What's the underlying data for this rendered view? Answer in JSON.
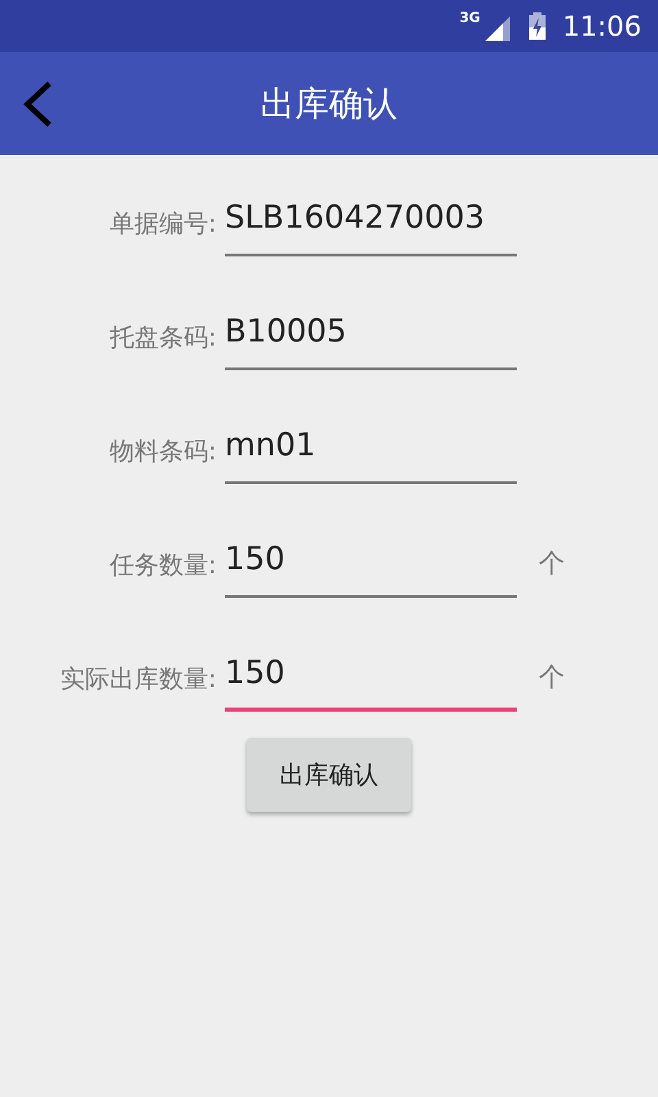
{
  "status_bar": {
    "network": "3G",
    "time": "11:06"
  },
  "app_bar": {
    "title": "出库确认"
  },
  "fields": [
    {
      "label": "单据编号:",
      "value": "SLB1604270003",
      "focused": false
    },
    {
      "label": "托盘条码:",
      "value": "B10005",
      "focused": false
    },
    {
      "label": "物料条码:",
      "value": "mn01",
      "focused": false
    },
    {
      "label": "任务数量:",
      "value": "150",
      "unit": "个",
      "focused": false
    },
    {
      "label": "实际出库数量:",
      "value": "150",
      "unit": "个",
      "focused": true
    }
  ],
  "button": "出库确认"
}
